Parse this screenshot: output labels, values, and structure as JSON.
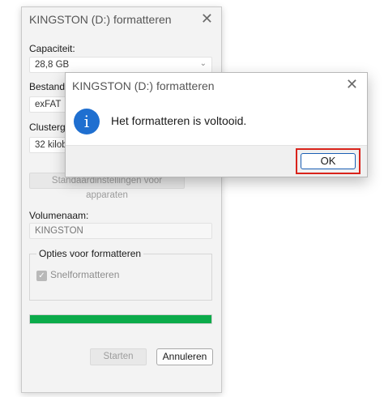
{
  "format_dialog": {
    "title": "KINGSTON (D:) formatteren",
    "close_glyph": "✕",
    "capacity_label": "Capaciteit:",
    "capacity_value": "28,8 GB",
    "filesystem_label": "Bestands",
    "filesystem_value": "exFAT",
    "cluster_label": "Clustergr",
    "cluster_value": "32 kilob",
    "defaults_button": "Standaardinstellingen voor apparaten",
    "volume_label": "Volumenaam:",
    "volume_value": "KINGSTON",
    "options_group_title": "Opties voor formatteren",
    "quick_format_label": "Snelformatteren",
    "quick_format_checked": true,
    "progress_fraction": 1.0,
    "start_button": "Starten",
    "cancel_button": "Annuleren"
  },
  "message_box": {
    "title": "KINGSTON (D:) formatteren",
    "close_glyph": "✕",
    "icon": "info-icon",
    "icon_glyph": "i",
    "message": "Het formatteren is voltooid.",
    "ok_button": "OK"
  },
  "colors": {
    "progress_green": "#0bab4a",
    "highlight_red": "#d9231b",
    "info_blue": "#1f6fd0"
  }
}
